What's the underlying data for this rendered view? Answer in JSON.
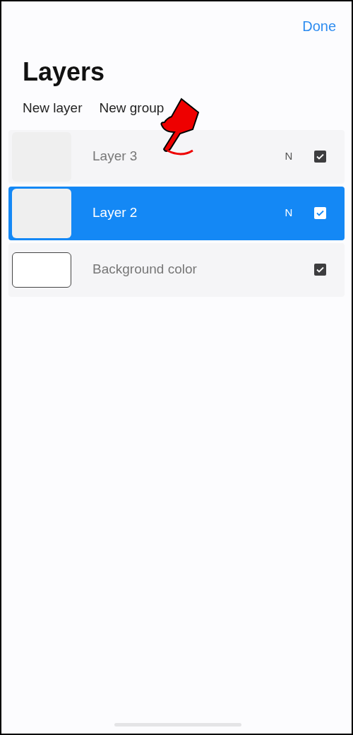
{
  "header": {
    "done": "Done",
    "title": "Layers"
  },
  "actions": [
    "New layer",
    "New group"
  ],
  "layers": [
    {
      "kind": "layer",
      "name": "Layer 3",
      "blend": "N",
      "visible": true,
      "selected": false
    },
    {
      "kind": "layer",
      "name": "Layer 2",
      "blend": "N",
      "visible": true,
      "selected": true
    },
    {
      "kind": "background",
      "name": "Background color",
      "visible": true,
      "selected": false
    }
  ]
}
